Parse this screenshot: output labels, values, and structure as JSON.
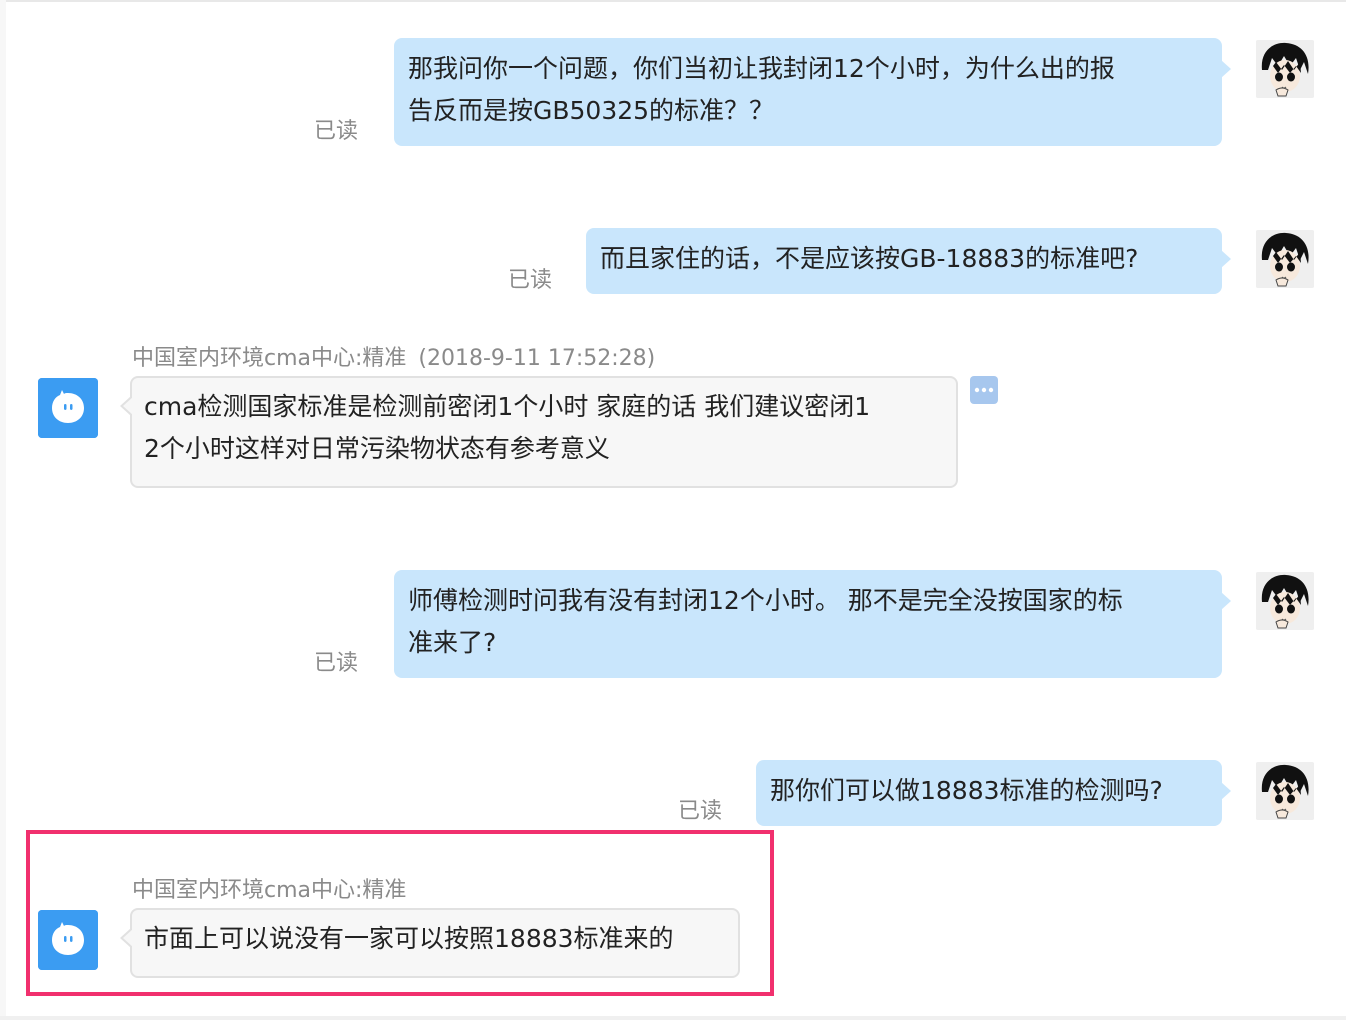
{
  "messages": [
    {
      "direction": "outgoing",
      "lines": [
        "那我问你一个问题，你们当初让我封闭12个小时，为什么出的报",
        "告反而是按GB50325的标准？？"
      ],
      "status": "已读"
    },
    {
      "direction": "outgoing",
      "lines": [
        "而且家住的话，不是应该按GB-18883的标准吧?"
      ],
      "status": "已读"
    },
    {
      "direction": "incoming",
      "sender": "中国室内环境cma中心:精准",
      "timestamp": "(2018-9-11 17:52:28)",
      "lines": [
        "cma检测国家标准是检测前密闭1个小时 家庭的话 我们建议密闭1",
        "2个小时这样对日常污染物状态有参考意义"
      ]
    },
    {
      "direction": "outgoing",
      "lines": [
        "师傅检测时问我有没有封闭12个小时。 那不是完全没按国家的标",
        "准来了?"
      ],
      "status": "已读"
    },
    {
      "direction": "outgoing",
      "lines": [
        "那你们可以做18883标准的检测吗?"
      ],
      "status": "已读"
    },
    {
      "direction": "incoming",
      "sender": "中国室内环境cma中心:精准",
      "lines": [
        "市面上可以说没有一家可以按照18883标准来的"
      ],
      "highlighted": true
    }
  ],
  "colors": {
    "outgoing_bubble": "#c9e6fc",
    "incoming_bubble": "#f7f7f7",
    "highlight": "#f1306e",
    "bot_avatar": "#3b9cf2"
  },
  "icons": {
    "user_avatar": "cartoon-avatar-icon",
    "bot_avatar": "chat-bubble-face-icon",
    "more": "ellipsis-icon"
  }
}
